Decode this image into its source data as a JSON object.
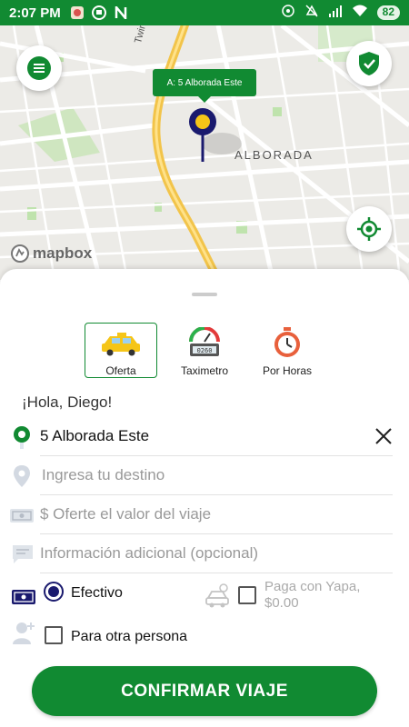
{
  "status_bar": {
    "time": "2:07 PM",
    "battery": "82",
    "left_icons": [
      "notification-icon",
      "bus-icon",
      "n-icon"
    ],
    "right_icons": [
      "hotspot-icon",
      "mute-icon",
      "signal-icon",
      "wifi-icon"
    ]
  },
  "map": {
    "pin_label": "A: 5 Alborada Este",
    "area_label": "ALBORADA",
    "street_label": "Twintz",
    "attribution": "mapbox",
    "menu_icon": "menu-icon",
    "shield_icon": "shield-check-icon",
    "locate_icon": "crosshair-icon"
  },
  "modes": [
    {
      "label": "Oferta",
      "icon": "taxi-icon",
      "active": true
    },
    {
      "label": "Taximetro",
      "icon": "taximeter-icon",
      "active": false
    },
    {
      "label": "Por Horas",
      "icon": "stopwatch-icon",
      "active": false
    }
  ],
  "greeting": "¡Hola, Diego!",
  "origin": {
    "value": "5 Alborada Este"
  },
  "destination": {
    "placeholder": "Ingresa tu destino"
  },
  "offer": {
    "placeholder": "$ Oferte el valor del viaje"
  },
  "info": {
    "placeholder": "Información adicional (opcional)"
  },
  "payment": {
    "cash_label": "Efectivo",
    "cash_selected": true,
    "yapa_line1": "Paga con Yapa,",
    "yapa_line2": "$0.00",
    "yapa_checked": false
  },
  "other_person": {
    "label": "Para otra persona",
    "checked": false
  },
  "confirm_label": "CONFIRMAR VIAJE",
  "colors": {
    "brand": "#118a32",
    "map_bg": "#ecebe7",
    "road": "#f2c44a",
    "radio": "#1a1a6e"
  }
}
